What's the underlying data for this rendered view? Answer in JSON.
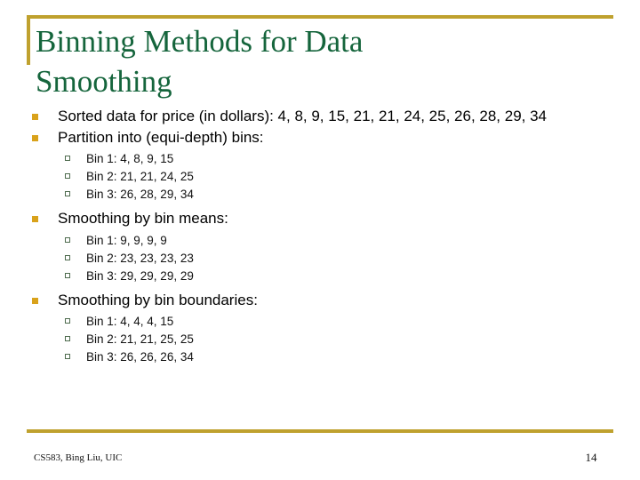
{
  "slide": {
    "title_line1": "Binning Methods for Data",
    "title_line2": "Smoothing",
    "title_color": "#15653c",
    "accent_color": "#bfa12e",
    "bullet_marker_color": "#d9a21b",
    "subbullet_marker_color": "#4e6b4e"
  },
  "content": {
    "bullets": [
      {
        "text": "Sorted data for price (in dollars): 4, 8, 9, 15, 21, 21, 24, 25, 26, 28, 29, 34",
        "sub": []
      },
      {
        "text": "Partition into (equi-depth) bins:",
        "sub": [
          "Bin 1: 4, 8, 9, 15",
          "Bin 2: 21, 21, 24, 25",
          "Bin 3: 26, 28, 29, 34"
        ]
      },
      {
        "text": "Smoothing by bin means:",
        "sub": [
          "Bin 1: 9, 9, 9, 9",
          "Bin 2: 23, 23, 23, 23",
          "Bin 3: 29, 29, 29, 29"
        ]
      },
      {
        "text": "Smoothing by bin boundaries:",
        "sub": [
          "Bin 1: 4, 4, 4, 15",
          "Bin 2: 21, 21, 25, 25",
          "Bin 3: 26, 26, 26, 34"
        ]
      }
    ]
  },
  "footer": {
    "credit": "CS583, Bing Liu, UIC",
    "page_number": "14"
  }
}
